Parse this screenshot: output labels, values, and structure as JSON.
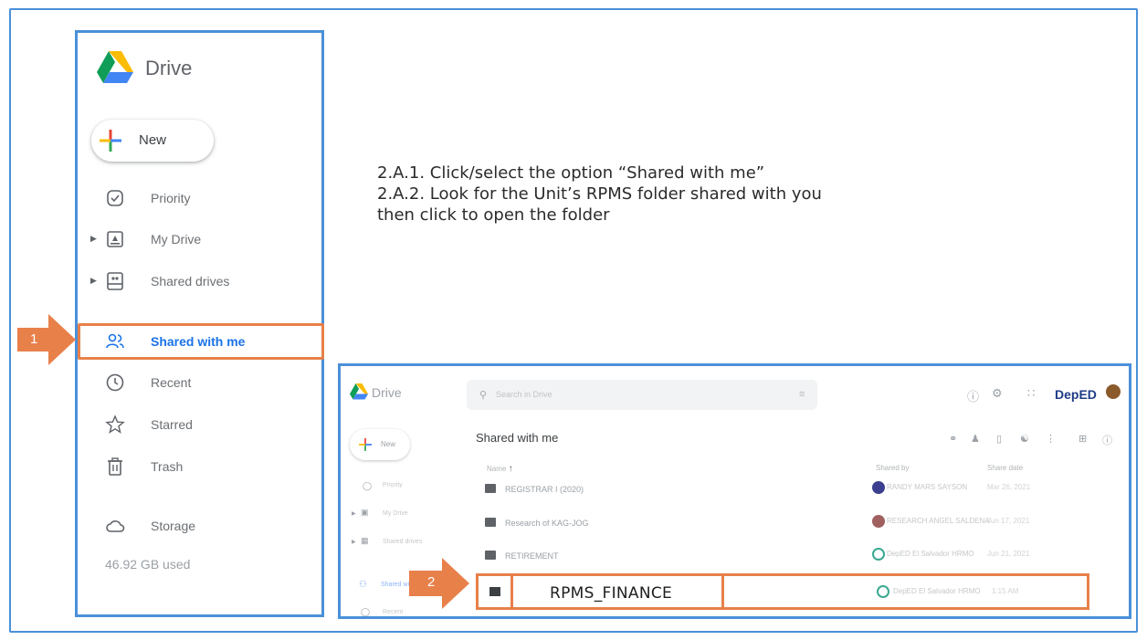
{
  "sidebar": {
    "brand": "Drive",
    "new_label": "New",
    "items": [
      {
        "label": "Priority",
        "icon": "check-circle-icon"
      },
      {
        "label": "My Drive",
        "icon": "drive-icon"
      },
      {
        "label": "Shared drives",
        "icon": "shared-drives-icon"
      },
      {
        "label": "Shared with me",
        "icon": "people-icon"
      },
      {
        "label": "Recent",
        "icon": "clock-icon"
      },
      {
        "label": "Starred",
        "icon": "star-icon"
      },
      {
        "label": "Trash",
        "icon": "trash-icon"
      },
      {
        "label": "Storage",
        "icon": "cloud-icon"
      }
    ],
    "storage_used": "46.92 GB used"
  },
  "markers": {
    "first": "1",
    "second": "2"
  },
  "instructions": [
    "2.A.1. Click/select the option “Shared with me”",
    "2.A.2. Look for the Unit’s RPMS folder shared with you",
    "then click to open the folder"
  ],
  "inset": {
    "brand": "Drive",
    "search_placeholder": "Search in Drive",
    "new_label": "New",
    "page_title": "Shared with me",
    "org_logo": "DepED",
    "columns": {
      "name": "Name",
      "shared_by": "Shared by",
      "share_date": "Share date"
    },
    "nav": [
      "Priority",
      "My Drive",
      "Shared drives",
      "Shared wi",
      "Recent"
    ],
    "rows": [
      {
        "name": "REGISTRAR I (2020)",
        "shared_by": "RANDY MARS SAYSON",
        "date": "Mar 26, 2021"
      },
      {
        "name": "Research of KAG-JOG",
        "shared_by": "RESEARCH ANGEL SALDENA",
        "date": "Jun 17, 2021"
      },
      {
        "name": "RETIREMENT",
        "shared_by": "DepED El Salvador HRMO",
        "date": "Jun 21, 2021"
      },
      {
        "name": "RPMS_FINANCE",
        "shared_by": "DepED El Salvador HRMO",
        "date": "1:15 AM"
      }
    ]
  },
  "colors": {
    "frame": "#4a90d9",
    "highlight": "#e8804a",
    "active_text": "#1a73e8"
  }
}
